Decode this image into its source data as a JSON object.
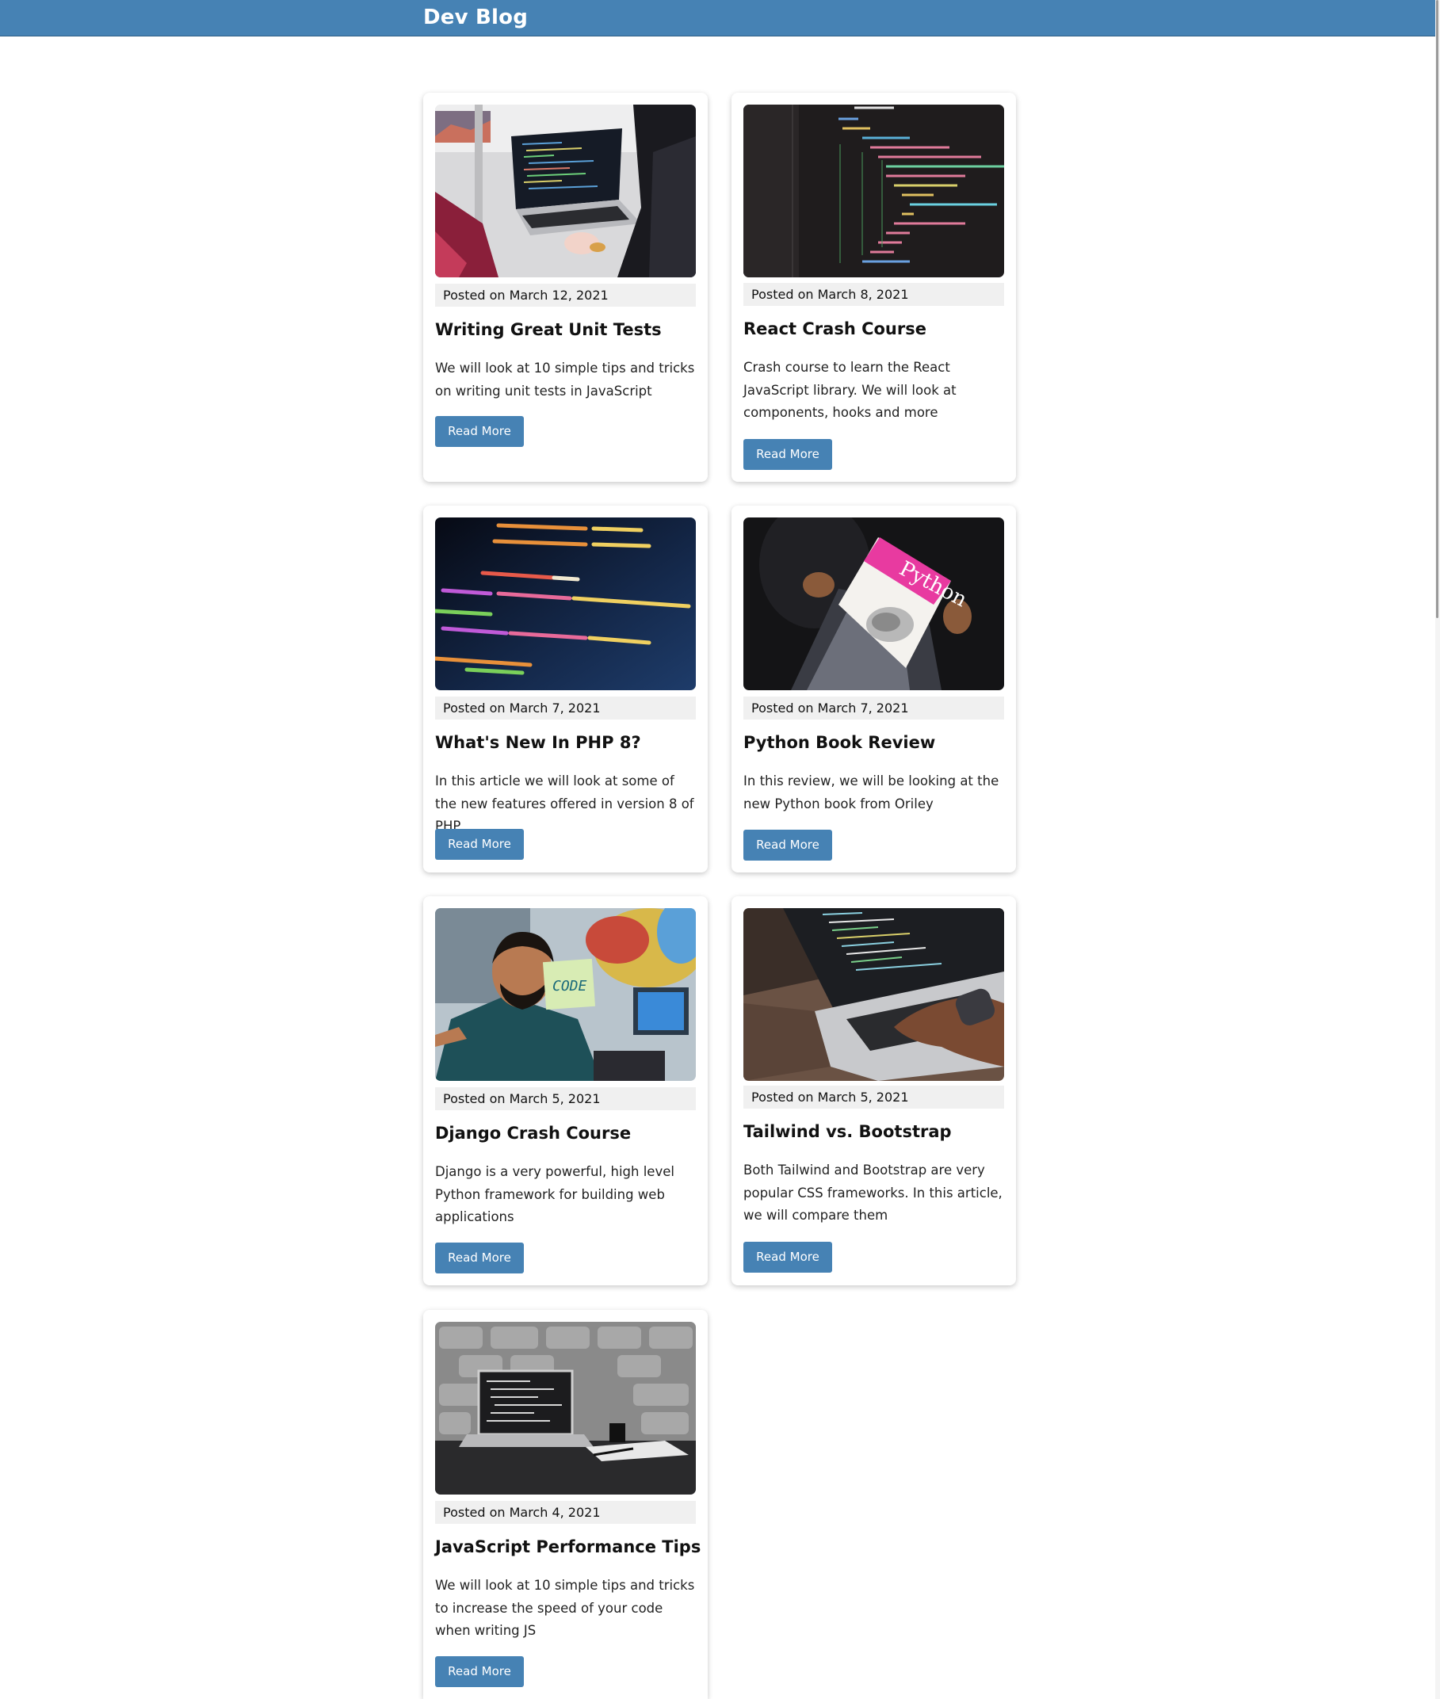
{
  "navbar": {
    "brand": "Dev Blog"
  },
  "posts": [
    {
      "date": "Posted on March 12, 2021",
      "title": "Writing Great Unit Tests",
      "excerpt": "We will look at 10 simple tips and tricks on writing unit tests in JavaScript",
      "button": "Read More",
      "image": "laptop-code-photo"
    },
    {
      "date": "Posted on March 8, 2021",
      "title": "React Crash Course",
      "excerpt": "Crash course to learn the React JavaScript library. We will look at components, hooks and more",
      "button": "Read More",
      "image": "react-code-photo"
    },
    {
      "date": "Posted on March 7, 2021",
      "title": "What's New In PHP 8?",
      "excerpt": "In this article we will look at some of the new features offered in version 8 of PHP",
      "button": "Read More",
      "image": "php-code-photo"
    },
    {
      "date": "Posted on March 7, 2021",
      "title": "Python Book Review",
      "excerpt": "In this review, we will be looking at the new Python book from Oriley",
      "button": "Read More",
      "image": "python-book-photo",
      "image_text": "Python"
    },
    {
      "date": "Posted on March 5, 2021",
      "title": "Django Crash Course",
      "excerpt": "Django is a very powerful, high level Python framework for building web applications",
      "button": "Read More",
      "image": "code-sticky-note-photo",
      "image_text": "CODE"
    },
    {
      "date": "Posted on March 5, 2021",
      "title": "Tailwind vs. Bootstrap",
      "excerpt": "Both Tailwind and Bootstrap are very popular CSS frameworks. In this article, we will compare them",
      "button": "Read More",
      "image": "typing-laptop-photo"
    },
    {
      "date": "Posted on March 4, 2021",
      "title": "JavaScript Performance Tips",
      "excerpt": "We will look at 10 simple tips and tricks to increase the speed of your code when writing JS",
      "button": "Read More",
      "image": "bw-laptop-desk-photo"
    }
  ]
}
